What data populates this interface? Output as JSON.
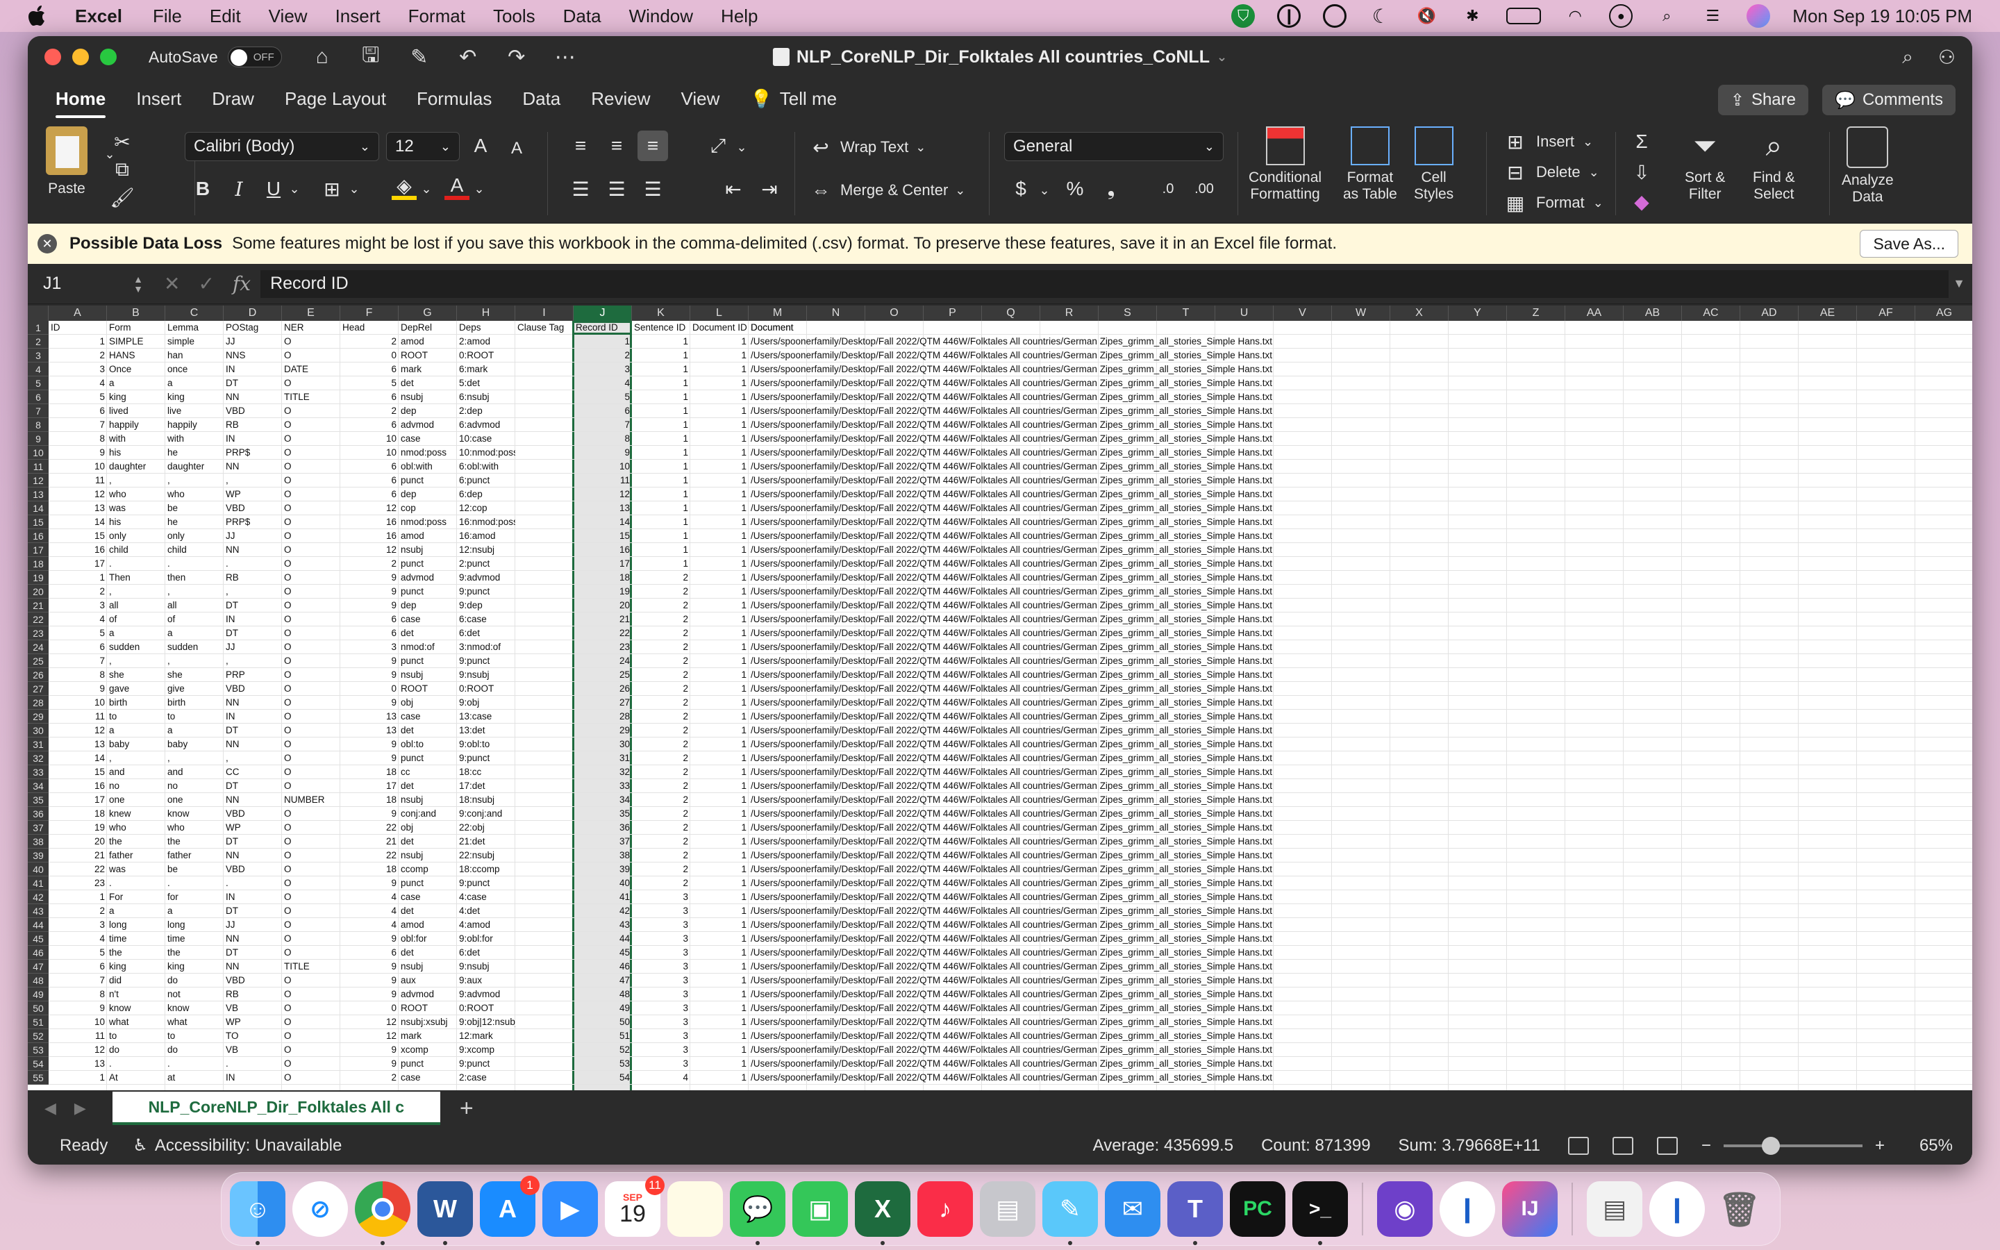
{
  "menubar": {
    "app_name": "Excel",
    "items": [
      "File",
      "Edit",
      "View",
      "Insert",
      "Format",
      "Tools",
      "Data",
      "Window",
      "Help"
    ],
    "clock": "Mon Sep 19  10:05 PM"
  },
  "window": {
    "autosave_label": "AutoSave",
    "autosave_state": "OFF",
    "title": "NLP_CoreNLP_Dir_Folktales All countries_CoNLL"
  },
  "ribbon_tabs": [
    "Home",
    "Insert",
    "Draw",
    "Page Layout",
    "Formulas",
    "Data",
    "Review",
    "View"
  ],
  "tell_me": "Tell me",
  "share_label": "Share",
  "comments_label": "Comments",
  "ribbon": {
    "paste": "Paste",
    "font_name": "Calibri (Body)",
    "font_size": "12",
    "wrap_text": "Wrap Text",
    "merge_center": "Merge & Center",
    "number_format": "General",
    "conditional_formatting": "Conditional\nFormatting",
    "format_as_table": "Format\nas Table",
    "cell_styles": "Cell\nStyles",
    "insert": "Insert",
    "delete": "Delete",
    "format": "Format",
    "sort_filter": "Sort &\nFilter",
    "find_select": "Find &\nSelect",
    "analyze_data": "Analyze\nData"
  },
  "infobar": {
    "title": "Possible Data Loss",
    "message": "Some features might be lost if you save this workbook in the comma-delimited (.csv) format. To preserve these features, save it in an Excel file format.",
    "save_as": "Save As..."
  },
  "formula_bar": {
    "cell_ref": "J1",
    "fx": "fx",
    "content": "Record ID"
  },
  "columns": [
    "A",
    "B",
    "C",
    "D",
    "E",
    "F",
    "G",
    "H",
    "I",
    "J",
    "K",
    "L",
    "M",
    "N",
    "O",
    "P",
    "Q",
    "R",
    "S",
    "T",
    "U",
    "V",
    "W",
    "X",
    "Y",
    "Z",
    "AA",
    "AB",
    "AC",
    "AD",
    "AE",
    "AF",
    "AG"
  ],
  "headers": [
    "ID",
    "Form",
    "Lemma",
    "POStag",
    "NER",
    "Head",
    "DepRel",
    "Deps",
    "Clause Tag",
    "Record ID",
    "Sentence ID",
    "Document ID",
    "Document"
  ],
  "document_path": "/Users/spoonerfamily/Desktop/Fall 2022/QTM 446W/Folktales All countries/German Zipes_grimm_all_stories_Simple Hans.txt",
  "rows": [
    [
      "1",
      "SIMPLE",
      "simple",
      "JJ",
      "O",
      "2",
      "amod",
      "2:amod",
      "",
      "1",
      "1",
      "1"
    ],
    [
      "2",
      "HANS",
      "han",
      "NNS",
      "O",
      "0",
      "ROOT",
      "0:ROOT",
      "",
      "2",
      "1",
      "1"
    ],
    [
      "3",
      "Once",
      "once",
      "IN",
      "DATE",
      "6",
      "mark",
      "6:mark",
      "",
      "3",
      "1",
      "1"
    ],
    [
      "4",
      "a",
      "a",
      "DT",
      "O",
      "5",
      "det",
      "5:det",
      "",
      "4",
      "1",
      "1"
    ],
    [
      "5",
      "king",
      "king",
      "NN",
      "TITLE",
      "6",
      "nsubj",
      "6:nsubj",
      "",
      "5",
      "1",
      "1"
    ],
    [
      "6",
      "lived",
      "live",
      "VBD",
      "O",
      "2",
      "dep",
      "2:dep",
      "",
      "6",
      "1",
      "1"
    ],
    [
      "7",
      "happily",
      "happily",
      "RB",
      "O",
      "6",
      "advmod",
      "6:advmod",
      "",
      "7",
      "1",
      "1"
    ],
    [
      "8",
      "with",
      "with",
      "IN",
      "O",
      "10",
      "case",
      "10:case",
      "",
      "8",
      "1",
      "1"
    ],
    [
      "9",
      "his",
      "he",
      "PRP$",
      "O",
      "10",
      "nmod:poss",
      "10:nmod:poss",
      "",
      "9",
      "1",
      "1"
    ],
    [
      "10",
      "daughter",
      "daughter",
      "NN",
      "O",
      "6",
      "obl:with",
      "6:obl:with",
      "",
      "10",
      "1",
      "1"
    ],
    [
      "11",
      ",",
      ",",
      ",",
      "O",
      "6",
      "punct",
      "6:punct",
      "",
      "11",
      "1",
      "1"
    ],
    [
      "12",
      "who",
      "who",
      "WP",
      "O",
      "6",
      "dep",
      "6:dep",
      "",
      "12",
      "1",
      "1"
    ],
    [
      "13",
      "was",
      "be",
      "VBD",
      "O",
      "12",
      "cop",
      "12:cop",
      "",
      "13",
      "1",
      "1"
    ],
    [
      "14",
      "his",
      "he",
      "PRP$",
      "O",
      "16",
      "nmod:poss",
      "16:nmod:poss",
      "",
      "14",
      "1",
      "1"
    ],
    [
      "15",
      "only",
      "only",
      "JJ",
      "O",
      "16",
      "amod",
      "16:amod",
      "",
      "15",
      "1",
      "1"
    ],
    [
      "16",
      "child",
      "child",
      "NN",
      "O",
      "12",
      "nsubj",
      "12:nsubj",
      "",
      "16",
      "1",
      "1"
    ],
    [
      "17",
      ".",
      ".",
      ".",
      "O",
      "2",
      "punct",
      "2:punct",
      "",
      "17",
      "1",
      "1"
    ],
    [
      "1",
      "Then",
      "then",
      "RB",
      "O",
      "9",
      "advmod",
      "9:advmod",
      "",
      "18",
      "2",
      "1"
    ],
    [
      "2",
      ",",
      ",",
      ",",
      "O",
      "9",
      "punct",
      "9:punct",
      "",
      "19",
      "2",
      "1"
    ],
    [
      "3",
      "all",
      "all",
      "DT",
      "O",
      "9",
      "dep",
      "9:dep",
      "",
      "20",
      "2",
      "1"
    ],
    [
      "4",
      "of",
      "of",
      "IN",
      "O",
      "6",
      "case",
      "6:case",
      "",
      "21",
      "2",
      "1"
    ],
    [
      "5",
      "a",
      "a",
      "DT",
      "O",
      "6",
      "det",
      "6:det",
      "",
      "22",
      "2",
      "1"
    ],
    [
      "6",
      "sudden",
      "sudden",
      "JJ",
      "O",
      "3",
      "nmod:of",
      "3:nmod:of",
      "",
      "23",
      "2",
      "1"
    ],
    [
      "7",
      ",",
      ",",
      ",",
      "O",
      "9",
      "punct",
      "9:punct",
      "",
      "24",
      "2",
      "1"
    ],
    [
      "8",
      "she",
      "she",
      "PRP",
      "O",
      "9",
      "nsubj",
      "9:nsubj",
      "",
      "25",
      "2",
      "1"
    ],
    [
      "9",
      "gave",
      "give",
      "VBD",
      "O",
      "0",
      "ROOT",
      "0:ROOT",
      "",
      "26",
      "2",
      "1"
    ],
    [
      "10",
      "birth",
      "birth",
      "NN",
      "O",
      "9",
      "obj",
      "9:obj",
      "",
      "27",
      "2",
      "1"
    ],
    [
      "11",
      "to",
      "to",
      "IN",
      "O",
      "13",
      "case",
      "13:case",
      "",
      "28",
      "2",
      "1"
    ],
    [
      "12",
      "a",
      "a",
      "DT",
      "O",
      "13",
      "det",
      "13:det",
      "",
      "29",
      "2",
      "1"
    ],
    [
      "13",
      "baby",
      "baby",
      "NN",
      "O",
      "9",
      "obl:to",
      "9:obl:to",
      "",
      "30",
      "2",
      "1"
    ],
    [
      "14",
      ",",
      ",",
      ",",
      "O",
      "9",
      "punct",
      "9:punct",
      "",
      "31",
      "2",
      "1"
    ],
    [
      "15",
      "and",
      "and",
      "CC",
      "O",
      "18",
      "cc",
      "18:cc",
      "",
      "32",
      "2",
      "1"
    ],
    [
      "16",
      "no",
      "no",
      "DT",
      "O",
      "17",
      "det",
      "17:det",
      "",
      "33",
      "2",
      "1"
    ],
    [
      "17",
      "one",
      "one",
      "NN",
      "NUMBER",
      "18",
      "nsubj",
      "18:nsubj",
      "",
      "34",
      "2",
      "1"
    ],
    [
      "18",
      "knew",
      "know",
      "VBD",
      "O",
      "9",
      "conj:and",
      "9:conj:and",
      "",
      "35",
      "2",
      "1"
    ],
    [
      "19",
      "who",
      "who",
      "WP",
      "O",
      "22",
      "obj",
      "22:obj",
      "",
      "36",
      "2",
      "1"
    ],
    [
      "20",
      "the",
      "the",
      "DT",
      "O",
      "21",
      "det",
      "21:det",
      "",
      "37",
      "2",
      "1"
    ],
    [
      "21",
      "father",
      "father",
      "NN",
      "O",
      "22",
      "nsubj",
      "22:nsubj",
      "",
      "38",
      "2",
      "1"
    ],
    [
      "22",
      "was",
      "be",
      "VBD",
      "O",
      "18",
      "ccomp",
      "18:ccomp",
      "",
      "39",
      "2",
      "1"
    ],
    [
      "23",
      ".",
      ".",
      ".",
      "O",
      "9",
      "punct",
      "9:punct",
      "",
      "40",
      "2",
      "1"
    ],
    [
      "1",
      "For",
      "for",
      "IN",
      "O",
      "4",
      "case",
      "4:case",
      "",
      "41",
      "3",
      "1"
    ],
    [
      "2",
      "a",
      "a",
      "DT",
      "O",
      "4",
      "det",
      "4:det",
      "",
      "42",
      "3",
      "1"
    ],
    [
      "3",
      "long",
      "long",
      "JJ",
      "O",
      "4",
      "amod",
      "4:amod",
      "",
      "43",
      "3",
      "1"
    ],
    [
      "4",
      "time",
      "time",
      "NN",
      "O",
      "9",
      "obl:for",
      "9:obl:for",
      "",
      "44",
      "3",
      "1"
    ],
    [
      "5",
      "the",
      "the",
      "DT",
      "O",
      "6",
      "det",
      "6:det",
      "",
      "45",
      "3",
      "1"
    ],
    [
      "6",
      "king",
      "king",
      "NN",
      "TITLE",
      "9",
      "nsubj",
      "9:nsubj",
      "",
      "46",
      "3",
      "1"
    ],
    [
      "7",
      "did",
      "do",
      "VBD",
      "O",
      "9",
      "aux",
      "9:aux",
      "",
      "47",
      "3",
      "1"
    ],
    [
      "8",
      "n't",
      "not",
      "RB",
      "O",
      "9",
      "advmod",
      "9:advmod",
      "",
      "48",
      "3",
      "1"
    ],
    [
      "9",
      "know",
      "know",
      "VB",
      "O",
      "0",
      "ROOT",
      "0:ROOT",
      "",
      "49",
      "3",
      "1"
    ],
    [
      "10",
      "what",
      "what",
      "WP",
      "O",
      "12",
      "nsubj:xsubj",
      "9:obj|12:nsubj:xsubj",
      "",
      "50",
      "3",
      "1"
    ],
    [
      "11",
      "to",
      "to",
      "TO",
      "O",
      "12",
      "mark",
      "12:mark",
      "",
      "51",
      "3",
      "1"
    ],
    [
      "12",
      "do",
      "do",
      "VB",
      "O",
      "9",
      "xcomp",
      "9:xcomp",
      "",
      "52",
      "3",
      "1"
    ],
    [
      "13",
      ".",
      ".",
      ".",
      "O",
      "9",
      "punct",
      "9:punct",
      "",
      "53",
      "3",
      "1"
    ],
    [
      "1",
      "At",
      "at",
      "IN",
      "O",
      "2",
      "case",
      "2:case",
      "",
      "54",
      "4",
      "1"
    ]
  ],
  "sheet_tab": "NLP_CoreNLP_Dir_Folktales All c",
  "status": {
    "ready": "Ready",
    "accessibility": "Accessibility: Unavailable",
    "average": "Average: 435699.5",
    "count": "Count: 871399",
    "sum": "Sum: 3.79668E+11",
    "zoom": "65%"
  },
  "dock_badges": {
    "appstore": "1",
    "calendar_badge": "11",
    "calendar_month": "SEP",
    "calendar_day": "19"
  },
  "colors": {
    "excel_green": "#1e6b3e",
    "window_bg": "#2b2b2b",
    "infobar_bg": "#fff8dc"
  }
}
